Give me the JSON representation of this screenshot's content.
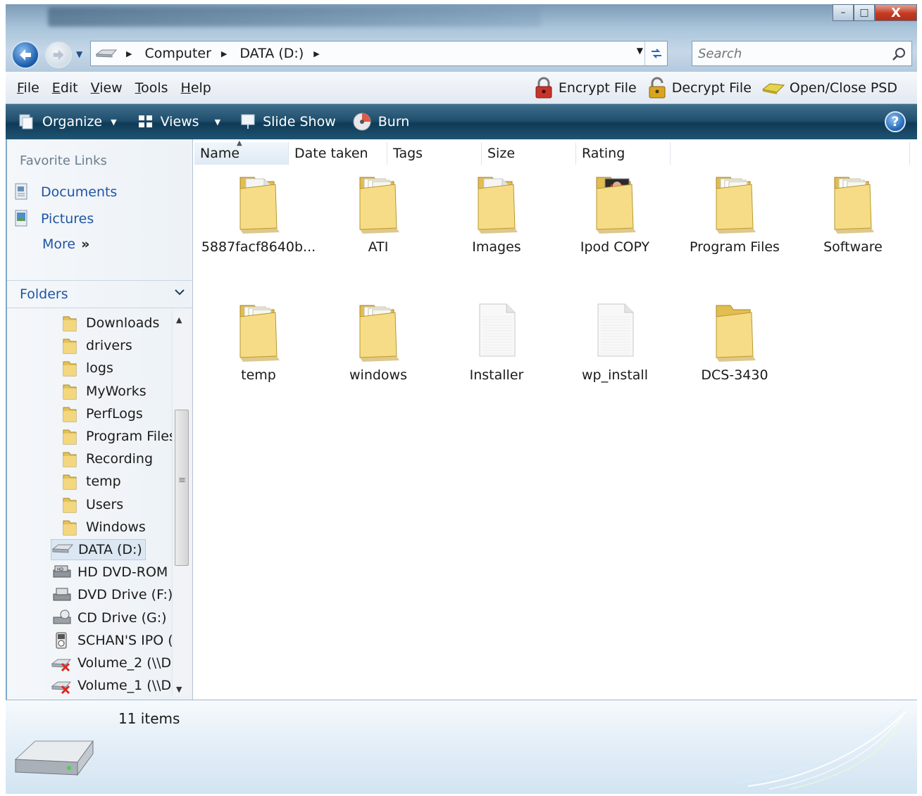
{
  "window": {
    "minimize": "–",
    "maximize": "□",
    "close": "X"
  },
  "address": {
    "breadcrumbs": [
      "Computer",
      "DATA (D:)"
    ],
    "search_placeholder": "Search"
  },
  "menu": [
    "File",
    "Edit",
    "View",
    "Tools",
    "Help"
  ],
  "menu_extras": [
    {
      "label": "Encrypt File",
      "icon": "lock-red-icon"
    },
    {
      "label": "Decrypt File",
      "icon": "lock-gold-icon"
    },
    {
      "label": "Open/Close PSD",
      "icon": "psd-icon"
    }
  ],
  "commands": [
    {
      "label": "Organize",
      "icon": "organize-icon",
      "dropdown": true
    },
    {
      "label": "Views",
      "icon": "views-icon",
      "dropdown": true
    },
    {
      "label": "Slide Show",
      "icon": "slideshow-icon",
      "dropdown": false
    },
    {
      "label": "Burn",
      "icon": "disc-icon",
      "dropdown": false
    }
  ],
  "favorites": {
    "heading": "Favorite Links",
    "links": [
      "Documents",
      "Pictures"
    ],
    "more": "More",
    "more_glyph": "»"
  },
  "folders_pane": {
    "heading": "Folders",
    "folders": [
      "Downloads",
      "drivers",
      "logs",
      "MyWorks",
      "PerfLogs",
      "Program Files",
      "Recording",
      "temp",
      "Users",
      "Windows"
    ],
    "drives": [
      {
        "label": "DATA (D:)",
        "icon": "hard-drive-icon",
        "selected": true
      },
      {
        "label": "HD DVD-ROM",
        "icon": "hd-dvd-drive-icon"
      },
      {
        "label": "DVD Drive (F:)",
        "icon": "dvd-drive-icon"
      },
      {
        "label": "CD Drive (G:)",
        "icon": "cd-drive-icon"
      },
      {
        "label": "SCHAN'S IPO (",
        "icon": "ipod-icon"
      },
      {
        "label": "Volume_2 (\\\\D",
        "icon": "network-drive-disconnected-icon"
      },
      {
        "label": "Volume_1 (\\\\D",
        "icon": "network-drive-disconnected-icon"
      }
    ]
  },
  "columns": [
    "Name",
    "Date taken",
    "Tags",
    "Size",
    "Rating"
  ],
  "items": [
    {
      "name": "5887facf8640b...",
      "type": "folder-doc"
    },
    {
      "name": "ATI",
      "type": "folder"
    },
    {
      "name": "Images",
      "type": "folder-doc"
    },
    {
      "name": "Ipod COPY",
      "type": "folder-photo"
    },
    {
      "name": "Program Files",
      "type": "folder"
    },
    {
      "name": "Software",
      "type": "folder"
    },
    {
      "name": "temp",
      "type": "folder"
    },
    {
      "name": "windows",
      "type": "folder"
    },
    {
      "name": "Installer",
      "type": "file"
    },
    {
      "name": "wp_install",
      "type": "file"
    },
    {
      "name": "DCS-3430",
      "type": "folder-empty"
    }
  ],
  "status": {
    "count": "11 items"
  }
}
